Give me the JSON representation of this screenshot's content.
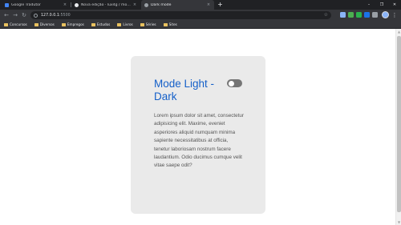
{
  "browser": {
    "tabs": [
      {
        "title": "Google Tradutor",
        "favicon_color": "#4285f4"
      },
      {
        "title": "Nova edição · lux4g / modo esc...",
        "favicon_color": "#e8eaed"
      },
      {
        "title": "Dark mode",
        "favicon_color": "#9aa0a6"
      }
    ],
    "new_tab_label": "+",
    "close_glyph": "×",
    "window_controls": {
      "minimize": "–",
      "maximize": "❐",
      "close": "✕"
    },
    "toolbar": {
      "back": "←",
      "forward": "→",
      "reload": "↻",
      "url_host": "127.0.0.1",
      "url_port": ":5500",
      "star": "☆",
      "menu": "⋮"
    },
    "bookmarks": [
      "Concursos",
      "Diversos",
      "Empregos",
      "Estudos",
      "Livros",
      "Séries",
      "Sites"
    ],
    "extension_icons": [
      "translate-extension-icon",
      "green-extension-icon",
      "feedly-extension-icon",
      "blue-extension-icon",
      "gray-extension-icon"
    ]
  },
  "page": {
    "title": "Mode Light - Dark",
    "body_text": "Lorem ipsum dolor sit amet, consectetur adipisicing elit. Maxime, eveniet asperiores aliquid numquam minima sapiente necessitatibus at officia, tenetur laboriosam nostrum facere laudantium. Odio ducimus cumque velit vitae saepe odit?",
    "dark_mode_toggle": {
      "on": false
    }
  },
  "colors": {
    "title": "#1560c9",
    "card_background": "#eaeaea",
    "toggle_track": "#757575",
    "chrome_dark": "#202124",
    "chrome_toolbar": "#35363a"
  }
}
